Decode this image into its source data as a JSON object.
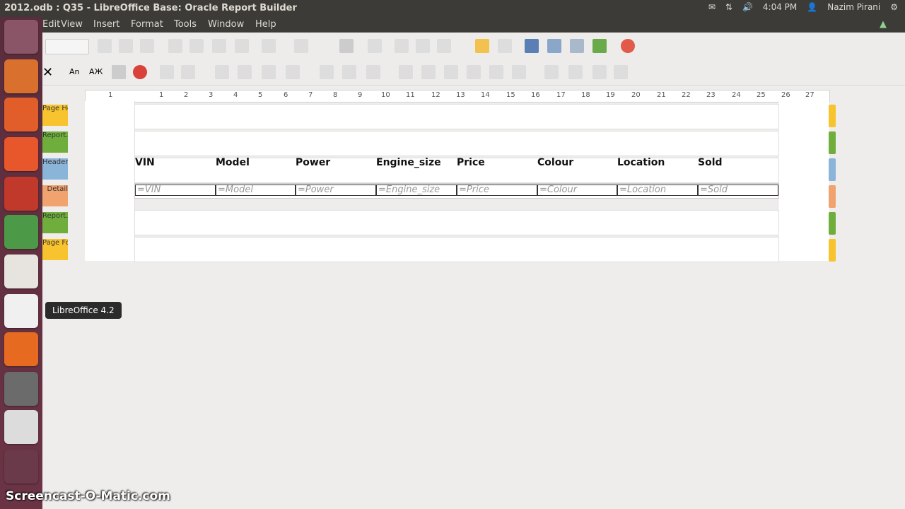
{
  "window": {
    "title": "2012.odb : Q35 - LibreOffice Base: Oracle Report Builder"
  },
  "tray": {
    "time": "4:04 PM",
    "user": "Nazim Pirani"
  },
  "menu": [
    "Edit",
    "View",
    "Insert",
    "Format",
    "Tools",
    "Window",
    "Help"
  ],
  "ruler": {
    "ticks": [
      "1",
      "1",
      "2",
      "3",
      "4",
      "5",
      "6",
      "7",
      "8",
      "9",
      "10",
      "11",
      "12",
      "13",
      "14",
      "15",
      "16",
      "17",
      "18",
      "19",
      "20",
      "21",
      "22",
      "23",
      "24",
      "25",
      "26",
      "27"
    ]
  },
  "sections": {
    "page_header": "Page He…",
    "report_header": "Report…",
    "header": "Header",
    "detail": "Detail",
    "report_footer": "Report…",
    "page_footer": "Page Fo…"
  },
  "columns": [
    "VIN",
    "Model",
    "Power",
    "Engine_size",
    "Price",
    "Colour",
    "Location",
    "Sold"
  ],
  "fields": [
    "=VIN",
    "=Model",
    "=Power",
    "=Engine_size",
    "=Price",
    "=Colour",
    "=Location",
    "=Sold"
  ],
  "tooltip": "LibreOffice 4.2",
  "watermark": "Screencast-O-Matic.com",
  "colors": {
    "page_header": "#f7c32e",
    "report_header": "#6fae3c",
    "header": "#8ab4d8",
    "detail": "#f0a36e",
    "report_footer": "#6fae3c",
    "page_footer": "#f7c32e"
  }
}
